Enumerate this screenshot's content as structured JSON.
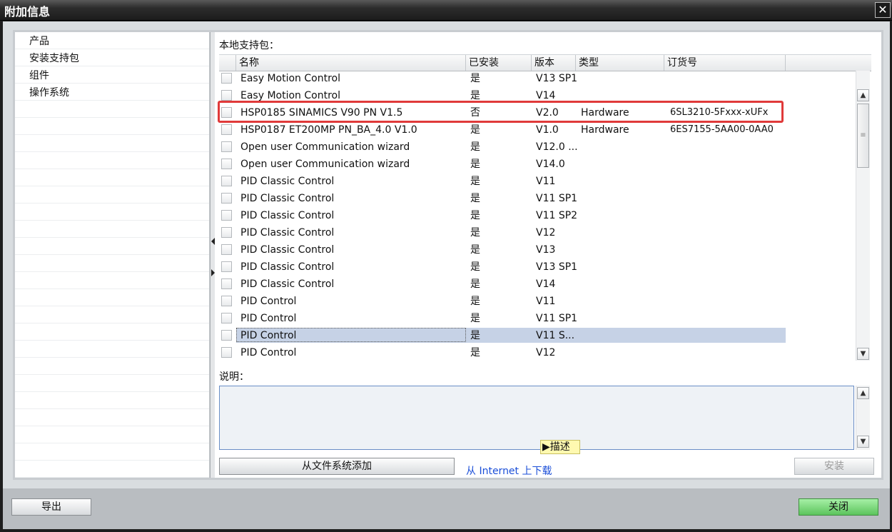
{
  "window": {
    "title": "附加信息",
    "close_glyph": "✕"
  },
  "nav": {
    "items": [
      "产品",
      "安装支持包",
      "组件",
      "操作系统"
    ]
  },
  "pane": {
    "local_label": "本地支持包：",
    "columns": [
      "名称",
      "已安装",
      "版本",
      "类型",
      "订货号"
    ],
    "rows": [
      {
        "name": "Easy Motion Control",
        "installed": "是",
        "version": "V13 SP1",
        "type": "",
        "order": ""
      },
      {
        "name": "Easy Motion Control",
        "installed": "是",
        "version": "V14",
        "type": "",
        "order": ""
      },
      {
        "name": "HSP0185 SINAMICS V90 PN V1.5",
        "installed": "否",
        "version": "V2.0",
        "type": "Hardware",
        "order": "6SL3210-5Fxxx-xUFx"
      },
      {
        "name": "HSP0187 ET200MP PN_BA_4.0 V1.0",
        "installed": "是",
        "version": "V1.0",
        "type": "Hardware",
        "order": "6ES7155-5AA00-0AA0"
      },
      {
        "name": "Open user Communication wizard",
        "installed": "是",
        "version": "V12.0 ...",
        "type": "",
        "order": ""
      },
      {
        "name": "Open user Communication wizard",
        "installed": "是",
        "version": "V14.0",
        "type": "",
        "order": ""
      },
      {
        "name": "PID Classic Control",
        "installed": "是",
        "version": "V11",
        "type": "",
        "order": ""
      },
      {
        "name": "PID Classic Control",
        "installed": "是",
        "version": "V11 SP1",
        "type": "",
        "order": ""
      },
      {
        "name": "PID Classic Control",
        "installed": "是",
        "version": "V11 SP2",
        "type": "",
        "order": ""
      },
      {
        "name": "PID Classic Control",
        "installed": "是",
        "version": "V12",
        "type": "",
        "order": ""
      },
      {
        "name": "PID Classic Control",
        "installed": "是",
        "version": "V13",
        "type": "",
        "order": ""
      },
      {
        "name": "PID Classic Control",
        "installed": "是",
        "version": "V13 SP1",
        "type": "",
        "order": ""
      },
      {
        "name": "PID Classic Control",
        "installed": "是",
        "version": "V14",
        "type": "",
        "order": ""
      },
      {
        "name": "PID Control",
        "installed": "是",
        "version": "V11",
        "type": "",
        "order": ""
      },
      {
        "name": "PID Control",
        "installed": "是",
        "version": "V11 SP1",
        "type": "",
        "order": ""
      },
      {
        "name": "PID Control",
        "installed": "是",
        "version": "V11 S...",
        "type": "",
        "order": ""
      },
      {
        "name": "PID Control",
        "installed": "是",
        "version": "V12",
        "type": "",
        "order": ""
      }
    ],
    "selected_row": "PID Control V11 S...",
    "description_label": "说明：",
    "description_tab": "描述",
    "add_from_fs_button": "从文件系统添加",
    "download_link": "从 Internet 上下载",
    "install_button": "安装"
  },
  "footer": {
    "export_button": "导出",
    "close_button": "关闭"
  },
  "icons": {
    "scroll_up": "chevron-up-icon",
    "scroll_down": "chevron-down-icon",
    "grip": "grip-icon",
    "collapse": "triangle-left-icon",
    "expand": "triangle-right-icon",
    "tab_marker": "triangle-right-icon"
  },
  "colors": {
    "highlight_box": "#e03a3a",
    "selected_row": "#c6d2e6",
    "close_button": "#6fd36f",
    "link": "#1a4ed8"
  }
}
